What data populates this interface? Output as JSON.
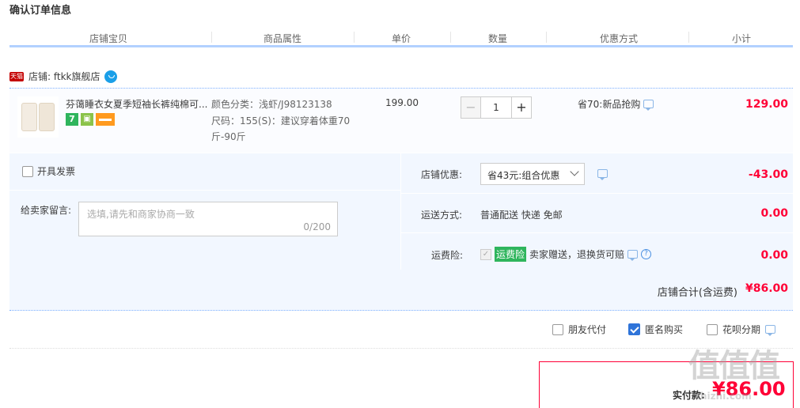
{
  "page_title": "确认订单信息",
  "columns": [
    "店铺宝贝",
    "商品属性",
    "单价",
    "数量",
    "优惠方式",
    "小计"
  ],
  "shop": {
    "badge": "天猫",
    "label": "店铺: ftkk旗舰店"
  },
  "item": {
    "title": "芬蔼睡衣女夏季短袖长裤纯棉可...",
    "attr_color": "颜色分类：浅虾/J98123138",
    "attr_size": "尺码：155(S)：建议穿着体重70斤-90斤",
    "price": "199.00",
    "quantity": "1",
    "promo": "省70:新品抢购",
    "subtotal": "129.00"
  },
  "invoice_label": "开具发票",
  "message": {
    "label": "给卖家留言:",
    "placeholder": "选填,请先和商家协商一致",
    "count": "0/200"
  },
  "shop_discount": {
    "label": "店铺优惠:",
    "selected": "省43元:组合优惠",
    "amount": "-43.00"
  },
  "shipping": {
    "label": "运送方式:",
    "value": "普通配送 快递 免邮",
    "amount": "0.00"
  },
  "insurance": {
    "label": "运费险:",
    "tag": "运费险",
    "text": "卖家赠送，退换货可赔",
    "amount": "0.00"
  },
  "shop_total": {
    "label": "店铺合计(含运费)",
    "amount": "¥86.00"
  },
  "pay_options": {
    "friend_pay": "朋友代付",
    "anonymous": "匿名购买",
    "huabei": "花呗分期"
  },
  "actual_pay": {
    "label": "实付款:",
    "amount": "¥86.00"
  },
  "watermark": {
    "text": "值值值",
    "url": "zhizhi.com"
  },
  "colors": {
    "accent_red": "#ff0036",
    "header_border": "#b2d1ff",
    "panel_bg": "#f2f7ff",
    "checkbox_blue": "#2f74d9"
  }
}
